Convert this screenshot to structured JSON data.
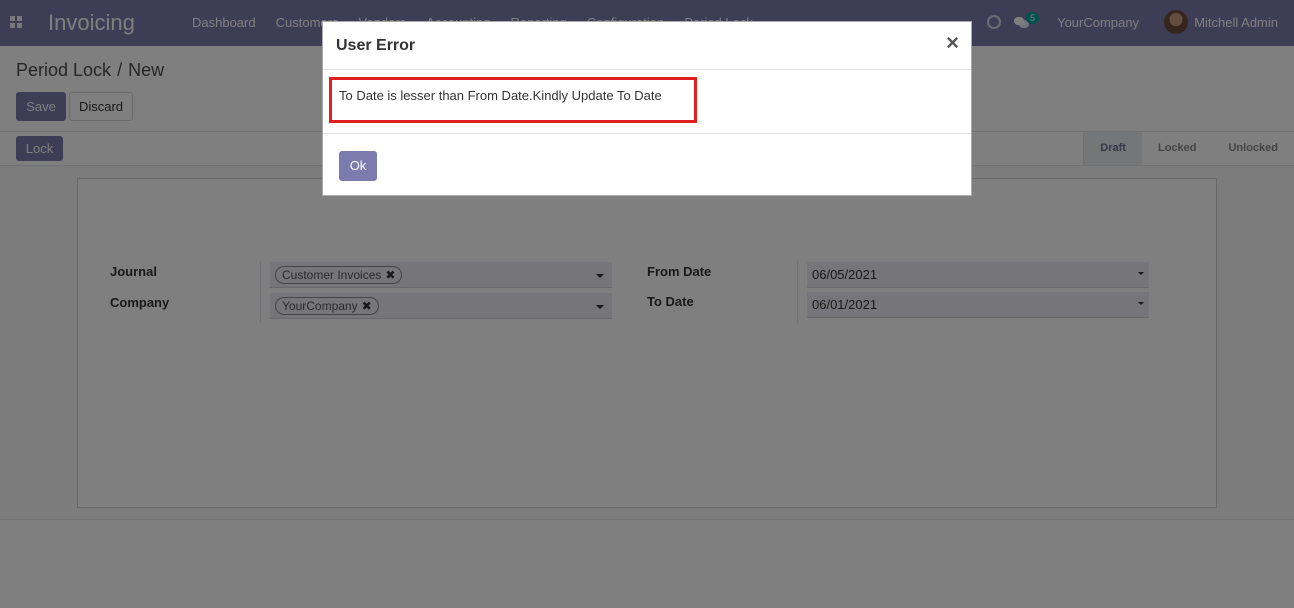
{
  "navbar": {
    "app_name": "Invoicing",
    "menu": [
      "Dashboard",
      "Customers",
      "Vendors",
      "Accounting",
      "Reporting",
      "Configuration",
      "Period Lock"
    ],
    "chat_count": "5",
    "company": "YourCompany",
    "user": "Mitchell Admin"
  },
  "breadcrumb": {
    "parent": "Period Lock",
    "separator": "/",
    "current": "New"
  },
  "toolbar": {
    "save_label": "Save",
    "discard_label": "Discard"
  },
  "statusbar": {
    "lock_label": "Lock",
    "stages": [
      "Draft",
      "Locked",
      "Unlocked"
    ],
    "active_stage": "Draft"
  },
  "form": {
    "journal_label": "Journal",
    "journal_value": "Customer Invoices",
    "company_label": "Company",
    "company_value": "YourCompany",
    "from_date_label": "From Date",
    "from_date_value": "06/05/2021",
    "to_date_label": "To Date",
    "to_date_value": "06/01/2021"
  },
  "modal": {
    "title": "User Error",
    "close_glyph": "×",
    "message": "To Date is lesser than From Date.Kindly Update To Date",
    "ok_label": "Ok"
  },
  "colors": {
    "brand": "#7c7bad",
    "error_border": "#e02020",
    "badge": "#00a09d"
  }
}
